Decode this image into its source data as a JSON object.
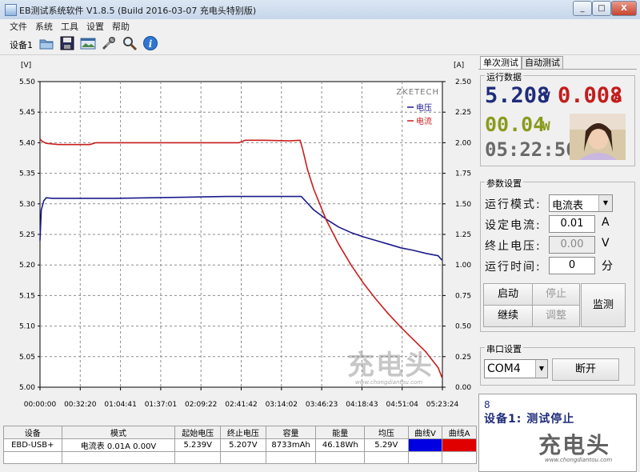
{
  "window": {
    "title": "EB测试系统软件 V1.8.5 (Build 2016-03-07 充电头特别版)",
    "min_label": "_",
    "max_label": "□",
    "close_label": "X"
  },
  "menu": [
    "文件",
    "系统",
    "工具",
    "设置",
    "帮助"
  ],
  "toolbar": {
    "device_label": "设备1",
    "tools": [
      "folder-icon",
      "save-icon",
      "image-icon",
      "tools-icon",
      "zoom-icon",
      "info-icon"
    ]
  },
  "chart_data": {
    "type": "line",
    "brand": "ZKETECH",
    "left_axis_unit": "[V]",
    "right_axis_unit": "[A]",
    "ylim_left": [
      5.0,
      5.5
    ],
    "ylim_right": [
      0.0,
      2.5
    ],
    "y_ticks_left": [
      "5.50",
      "5.45",
      "5.40",
      "5.35",
      "5.30",
      "5.25",
      "5.20",
      "5.15",
      "5.10",
      "5.05",
      "5.00"
    ],
    "y_ticks_right": [
      "2.50",
      "2.25",
      "2.00",
      "1.75",
      "1.50",
      "1.25",
      "1.00",
      "0.75",
      "0.50",
      "0.25",
      "0.00"
    ],
    "x_ticks": [
      "00:00:00",
      "00:32:20",
      "01:04:41",
      "01:37:01",
      "02:09:22",
      "02:41:42",
      "03:14:02",
      "03:46:23",
      "04:18:43",
      "04:51:04",
      "05:23:24"
    ],
    "xlim_seconds": [
      0,
      19404
    ],
    "grid": true,
    "legend_position": "top-right",
    "series": [
      {
        "name": "电压",
        "axis": "left",
        "color": "#1a1a8c",
        "x": [
          "00:00:00",
          "00:01:00",
          "00:03:00",
          "00:05:00",
          "00:10:00",
          "00:30:00",
          "01:00:00",
          "01:30:00",
          "02:00:00",
          "02:30:00",
          "03:00:00",
          "03:30:00",
          "03:35:00",
          "03:40:00",
          "03:50:00",
          "04:00:00",
          "04:10:00",
          "04:20:00",
          "04:30:00",
          "04:40:00",
          "04:50:00",
          "05:00:00",
          "05:10:00",
          "05:20:00",
          "05:23:00"
        ],
        "y": [
          5.24,
          5.29,
          5.305,
          5.31,
          5.309,
          5.309,
          5.309,
          5.31,
          5.311,
          5.312,
          5.312,
          5.312,
          5.301,
          5.29,
          5.275,
          5.262,
          5.253,
          5.246,
          5.24,
          5.234,
          5.228,
          5.224,
          5.219,
          5.215,
          5.208
        ]
      },
      {
        "name": "电流",
        "axis": "right",
        "color": "#c81e1e",
        "x": [
          "00:00:00",
          "00:02:00",
          "00:05:00",
          "00:15:00",
          "00:40:00",
          "00:45:00",
          "01:00:00",
          "02:00:00",
          "02:30:00",
          "02:40:00",
          "02:45:00",
          "03:00:00",
          "03:20:00",
          "03:29:00",
          "03:31:00",
          "03:35:00",
          "03:40:00",
          "03:50:00",
          "04:00:00",
          "04:10:00",
          "04:20:00",
          "04:30:00",
          "04:40:00",
          "04:50:00",
          "05:00:00",
          "05:10:00",
          "05:20:00",
          "05:23:00"
        ],
        "y": [
          2.03,
          2.01,
          1.995,
          1.985,
          1.985,
          2.0,
          2.0,
          2.0,
          2.0,
          2.0,
          2.02,
          2.02,
          2.015,
          2.02,
          1.95,
          1.78,
          1.62,
          1.37,
          1.17,
          1.0,
          0.85,
          0.72,
          0.6,
          0.49,
          0.39,
          0.29,
          0.16,
          0.08
        ]
      }
    ]
  },
  "right_panel": {
    "tabs": [
      "单次测试",
      "自动测试"
    ],
    "run_group_title": "运行数据",
    "voltage_value": "5.208",
    "voltage_unit": "V",
    "current_value": "0.008",
    "current_unit": "A",
    "power_value": "00.04",
    "power_unit": "W",
    "time_value": "05:22:56",
    "param_group_title": "参数设置",
    "mode_label": "运行模式:",
    "mode_value": "电流表",
    "current_set_label": "设定电流:",
    "current_set_value": "0.01",
    "current_set_unit": "A",
    "end_voltage_label": "终止电压:",
    "end_voltage_value": "0.00",
    "end_voltage_unit": "V",
    "run_time_label": "运行时间:",
    "run_time_value": "0",
    "run_time_unit": "分",
    "start_label": "启动",
    "stop_label": "停止",
    "continue_label": "继续",
    "adjust_label": "调整",
    "monitor_label": "监测",
    "serial_group_title": "串口设置",
    "com_value": "COM4",
    "disconnect_label": "断开",
    "status_number": "8",
    "status_text": "设备1: 测试停止"
  },
  "table": {
    "headers": [
      "设备",
      "模式",
      "起始电压",
      "终止电压",
      "容量",
      "能量",
      "均压",
      "曲线V",
      "曲线A"
    ],
    "row": [
      "EBD-USB+",
      "电流表  0.01A  0.00V",
      "5.239V",
      "5.207V",
      "8733mAh",
      "46.18Wh",
      "5.29V"
    ],
    "curve_v_color": "#0000e0",
    "curve_a_color": "#e00000"
  },
  "watermark": {
    "logo_text": "充电头",
    "site_text": "www.chongdiantou.com"
  }
}
